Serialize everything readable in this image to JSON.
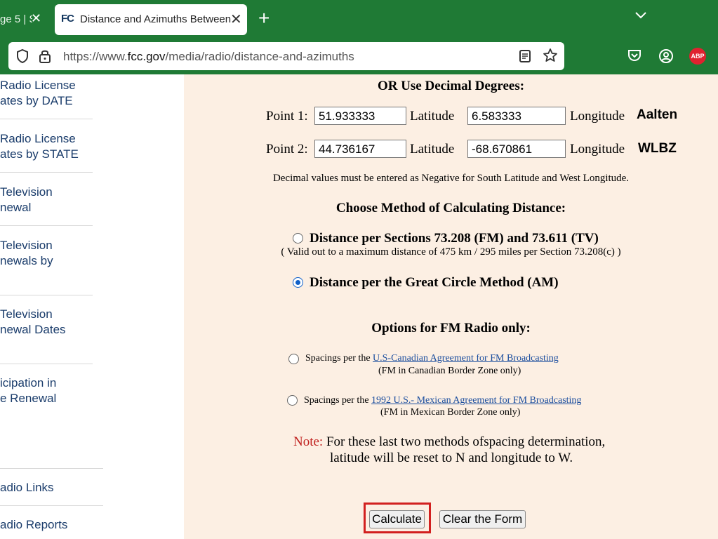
{
  "browser": {
    "tabs": [
      {
        "title": "ge 5 | S",
        "active": false
      },
      {
        "title": "Distance and Azimuths Between",
        "active": true
      }
    ],
    "favicon_text": "FC",
    "url_prefix": "https://www.",
    "url_domain": "fcc.gov",
    "url_path": "/media/radio/distance-and-azimuths",
    "abp_label": "ABP"
  },
  "sidebar": {
    "items": [
      {
        "lines": [
          "Radio License",
          "ates by DATE"
        ]
      },
      {
        "lines": [
          "Radio License",
          "ates by STATE"
        ]
      },
      {
        "lines": [
          "Television",
          "newal"
        ]
      },
      {
        "lines": [
          "Television",
          "newals by"
        ]
      },
      {
        "lines": [
          "Television",
          "newal Dates"
        ]
      },
      {
        "lines": [
          "icipation in",
          "e Renewal"
        ]
      },
      {
        "lines": [
          "adio Links"
        ]
      },
      {
        "lines": [
          "adio Reports"
        ]
      }
    ]
  },
  "form": {
    "decimal_heading": "OR Use Decimal Degrees:",
    "point1_label": "Point 1:",
    "point2_label": "Point 2:",
    "latitude_label": "Latitude",
    "longitude_label": "Longitude",
    "point1_lat": "51.933333",
    "point1_lon": "6.583333",
    "point1_name": "Aalten",
    "point2_lat": "44.736167",
    "point2_lon": "-68.670861",
    "point2_name": "WLBZ",
    "decimal_note": "Decimal values must be entered as Negative for South Latitude and West Longitude.",
    "method_heading": "Choose Method of Calculating Distance:",
    "method_sections": "Distance per Sections 73.208 (FM) and 73.611 (TV)",
    "method_sections_note": "( Valid out to a maximum distance of 475 km / 295 miles per Section 73.208(c) )",
    "method_great_circle": "Distance per the Great Circle Method (AM)",
    "selected_method": "great_circle",
    "fm_heading": "Options for FM Radio only:",
    "spacings_prefix": "Spacings per the ",
    "canada_link": "U.S-Canadian Agreement for FM Broadcasting",
    "canada_note": "(FM in Canadian Border Zone only)",
    "mexico_link": "1992 U.S.- Mexican Agreement for FM Broadcasting",
    "mexico_note": "(FM in Mexican Border Zone only)",
    "note_label": "Note:",
    "note_line1": "For these last two methods ofspacing determination,",
    "note_line2": "latitude will be reset to N and longitude to W.",
    "calculate_label": "Calculate",
    "clear_label": "Clear the Form"
  },
  "colors": {
    "chrome_green": "#1f7a35",
    "page_bg": "#fcefe3",
    "note_red": "#c0211f",
    "highlight_red": "#d2201f",
    "link_blue": "#1a4d9e",
    "sidebar_link": "#1a3c6b"
  }
}
